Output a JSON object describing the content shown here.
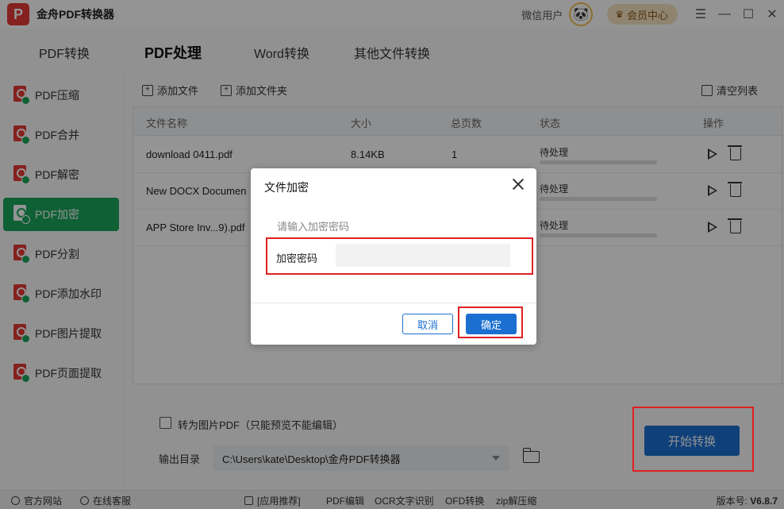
{
  "app": {
    "title": "金舟PDF转换器",
    "logo_text": "P",
    "user_name": "微信用户",
    "vip_label": "会员中心"
  },
  "main_tabs": [
    {
      "label": "PDF转换",
      "active": false
    },
    {
      "label": "PDF处理",
      "active": true
    },
    {
      "label": "Word转换",
      "active": false
    },
    {
      "label": "其他文件转换",
      "active": false
    }
  ],
  "sidebar": {
    "items": [
      {
        "label": "PDF压缩",
        "active": false
      },
      {
        "label": "PDF合并",
        "active": false
      },
      {
        "label": "PDF解密",
        "active": false
      },
      {
        "label": "PDF加密",
        "active": true
      },
      {
        "label": "PDF分割",
        "active": false
      },
      {
        "label": "PDF添加水印",
        "active": false
      },
      {
        "label": "PDF图片提取",
        "active": false
      },
      {
        "label": "PDF页面提取",
        "active": false
      }
    ]
  },
  "toolbar": {
    "add_file": "添加文件",
    "add_folder": "添加文件夹",
    "clear_list": "清空列表"
  },
  "table": {
    "columns": [
      "文件名称",
      "大小",
      "总页数",
      "状态",
      "操作"
    ],
    "rows": [
      {
        "name": "download 0411.pdf",
        "size": "8.14KB",
        "pages": "1",
        "status": "待处理",
        "progress": 0
      },
      {
        "name": "New DOCX Documen",
        "size": "",
        "pages": "",
        "status": "待处理",
        "progress": 0
      },
      {
        "name": "APP Store Inv...9).pdf",
        "size": "",
        "pages": "",
        "status": "待处理",
        "progress": 0
      }
    ]
  },
  "bottom": {
    "checkbox_label": "转为图片PDF（只能预览不能编辑）",
    "checkbox_checked": false,
    "output_label": "输出目录",
    "output_path": "C:\\Users\\kate\\Desktop\\金舟PDF转换器",
    "start_button": "开始转换"
  },
  "statusbar": {
    "website": "官方网站",
    "service": "在线客服",
    "recommend": "[应用推荐]",
    "links": [
      "PDF编辑",
      "OCR文字识别",
      "OFD转换",
      "zip解压缩"
    ],
    "version_label": "版本号:",
    "version": "V6.8.7"
  },
  "dialog": {
    "title": "文件加密",
    "hint": "请输入加密密码",
    "field_label": "加密密码",
    "password_value": "",
    "cancel": "取消",
    "ok": "确定"
  },
  "colors": {
    "accent_green": "#1aa55a",
    "accent_blue": "#1a6fd1",
    "highlight_red": "#e02020",
    "brand_red": "#e53935"
  }
}
